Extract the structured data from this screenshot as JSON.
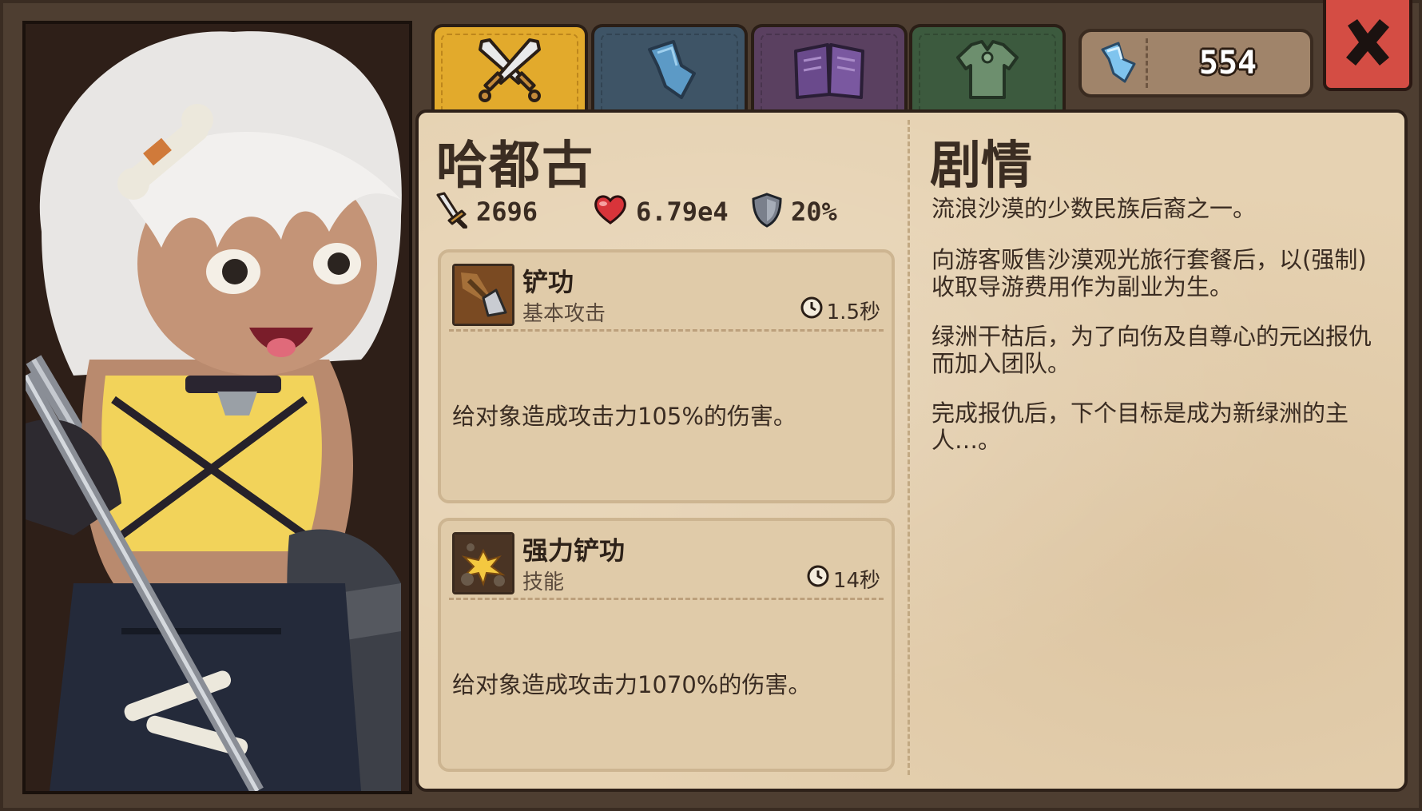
{
  "tabs": [
    {
      "name": "weapon-tab",
      "icon": "crossed-swords-icon",
      "selected": true
    },
    {
      "name": "crystal-tab",
      "icon": "crystal-icon",
      "selected": false
    },
    {
      "name": "book-tab",
      "icon": "book-icon",
      "selected": false
    },
    {
      "name": "armor-tab",
      "icon": "armor-icon",
      "selected": false
    }
  ],
  "currency": {
    "icon": "crystal-icon",
    "value": "554"
  },
  "close_icon": "close-x-icon",
  "character": {
    "name": "哈都古",
    "stats": {
      "attack": "2696",
      "hp": "6.79e4",
      "defense": "20%"
    }
  },
  "skills": [
    {
      "name": "铲功",
      "type": "基本攻击",
      "cooldown": "1.5秒",
      "description": "给对象造成攻击力105%的伤害。",
      "icon": "shovel-icon"
    },
    {
      "name": "强力铲功",
      "type": "技能",
      "cooldown": "14秒",
      "description": "给对象造成攻击力1070%的伤害。",
      "icon": "explosion-icon"
    }
  ],
  "story": {
    "title": "剧情",
    "paragraphs": [
      "流浪沙漠的少数民族后裔之一。",
      "向游客贩售沙漠观光旅行套餐后，以(强制)收取导游费用作为副业为生。",
      "绿洲干枯后，为了向伤及自尊心的元凶报仇而加入团队。",
      "完成报仇后，下个目标是成为新绿洲的主人…。"
    ]
  },
  "colors": {
    "parchment": "#e6d2b2",
    "tab_selected": "#e2aa2c",
    "close_button": "#d44d44"
  }
}
